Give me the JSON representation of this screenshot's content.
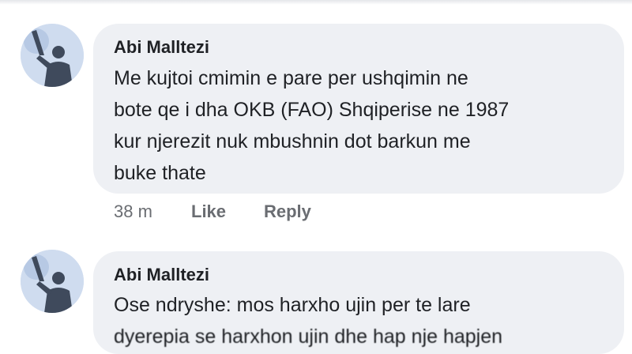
{
  "comments": [
    {
      "author": "Abi Malltezi",
      "lines": [
        "Me kujtoi cmimin e pare per ushqimin ne",
        "bote qe i dha OKB (FAO) Shqiperise ne 1987",
        "kur njerezit nuk mbushnin dot barkun me",
        "buke thate"
      ],
      "actions": {
        "time": "38 m",
        "like": "Like",
        "reply": "Reply"
      }
    },
    {
      "author": "Abi Malltezi",
      "lines": [
        "Ose ndryshe: mos harxho ujin per te lare",
        "dyerepia se harxhon ujin dhe hap nje hapjen"
      ]
    }
  ],
  "colors": {
    "bubble": "#eef0f4",
    "text": "#1f2125",
    "meta": "#6a6d72"
  },
  "icons": [
    "avatar-photo"
  ]
}
